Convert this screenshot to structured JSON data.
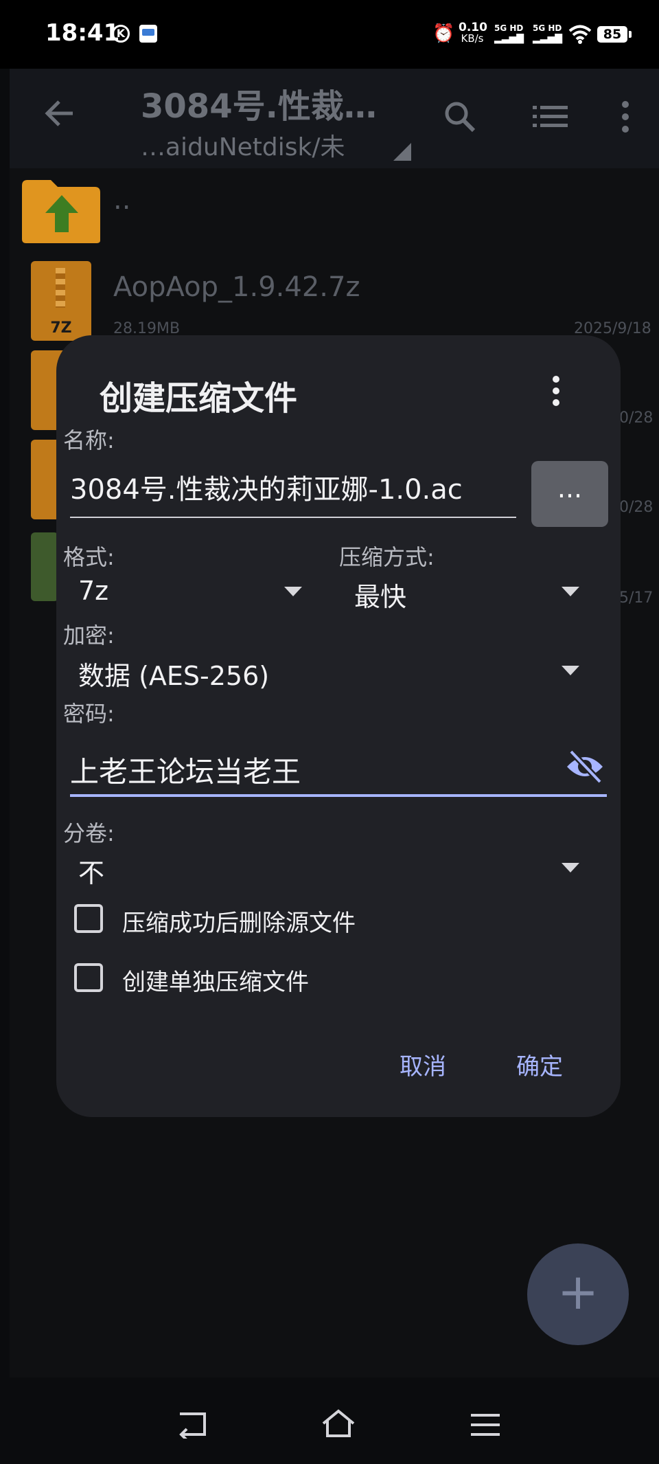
{
  "status_bar": {
    "time": "18:41",
    "network_speed": "0.10",
    "network_unit": "KB/s",
    "sim1": "5G HD",
    "sim2": "5G HD",
    "battery": "85"
  },
  "app_bar": {
    "title": "3084号.性裁…",
    "subtitle": "…aiduNetdisk/未"
  },
  "files": [
    {
      "name": "..",
      "size": "",
      "date": ""
    },
    {
      "name": "AopAop_1.9.42.7z",
      "size": "28.19MB",
      "date": "2025/9/18"
    },
    {
      "name": "",
      "size": "",
      "date": "0/28"
    },
    {
      "name": "",
      "size": "",
      "date": "0/28"
    },
    {
      "name": "",
      "size": "",
      "date": "5/17"
    }
  ],
  "file_type_label": "7Z",
  "dialog": {
    "title": "创建压缩文件",
    "name_label": "名称:",
    "name_value": "3084号.性裁决的莉亚娜-1.0.ac",
    "more_button": "...",
    "format_label": "格式:",
    "format_value": "7z",
    "method_label": "压缩方式:",
    "method_value": "最快",
    "encryption_label": "加密:",
    "encryption_value": "数据 (AES-256)",
    "password_label": "密码:",
    "password_value": "上老王论坛当老王",
    "split_label": "分卷:",
    "split_value": "不",
    "checkbox_delete": "压缩成功后删除源文件",
    "checkbox_separate": "创建单独压缩文件",
    "cancel": "取消",
    "ok": "确定"
  },
  "fab_label": "+",
  "colors": {
    "accent": "#a7b5ff",
    "dialog_bg": "#202126",
    "folder": "#e0951f",
    "arrow_green": "#3d7d22"
  }
}
